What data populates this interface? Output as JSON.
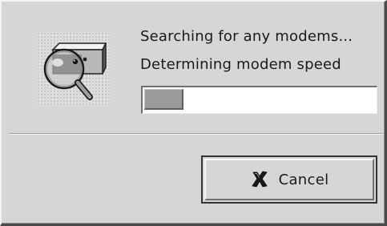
{
  "dialog": {
    "status_primary": "Searching for any modems...",
    "status_secondary": "Determining modem speed",
    "progress_fraction": 0.17,
    "icon": "modem-search-magnifier-icon",
    "cancel_button": {
      "label": "Cancel",
      "icon": "cancel-x-icon"
    }
  },
  "colors": {
    "dialog_background": "#d6d6d6",
    "progress_fill": "#9a9a9a",
    "progress_track": "#ffffff",
    "text": "#1a1a1a"
  }
}
